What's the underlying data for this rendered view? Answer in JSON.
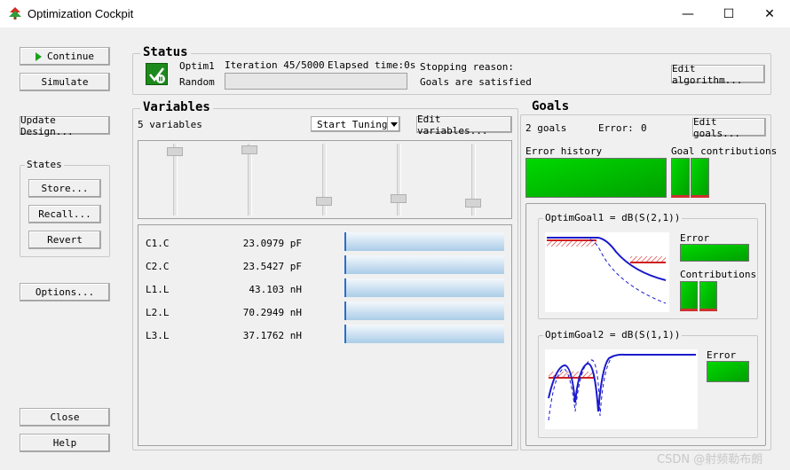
{
  "window": {
    "title": "Optimization Cockpit",
    "minimize": "—",
    "maximize": "☐",
    "close": "✕"
  },
  "left": {
    "continue": "Continue",
    "simulate": "Simulate",
    "update_design": "Update Design...",
    "states_title": "States",
    "store": "Store...",
    "recall": "Recall...",
    "revert": "Revert",
    "options": "Options...",
    "close_btn": "Close",
    "help": "Help"
  },
  "status": {
    "title": "Status",
    "optimizer": "Optim1",
    "method": "Random",
    "iteration": "Iteration 45/5000",
    "elapsed": "Elapsed time:0s",
    "progress": 0.0,
    "stopping_label": "Stopping reason:",
    "stopping_value": "Goals are satisfied",
    "edit_algorithm": "Edit algorithm..."
  },
  "variables": {
    "title": "Variables",
    "count": "5 variables",
    "start_tuning": "Start Tuning",
    "edit_variables": "Edit variables...",
    "sliders": [
      0.05,
      0.03,
      0.85,
      0.8,
      0.88
    ],
    "items": [
      {
        "name": "C1.C",
        "value": "23.0979 pF",
        "fill": 1.0
      },
      {
        "name": "C2.C",
        "value": "23.5427 pF",
        "fill": 1.0
      },
      {
        "name": "L1.L",
        "value": "43.103 nH",
        "fill": 1.0
      },
      {
        "name": "L2.L",
        "value": "70.2949 nH",
        "fill": 1.0
      },
      {
        "name": "L3.L",
        "value": "37.1762 nH",
        "fill": 1.0
      }
    ]
  },
  "goals": {
    "title": "Goals",
    "count": "2 goals",
    "error_label": "Error:",
    "error_value": "0",
    "edit_goals": "Edit goals...",
    "error_history": "Error history",
    "goal_contributions": "Goal contributions",
    "goal1": {
      "name": "OptimGoal1 = dB(S(2,1))",
      "error": "Error",
      "contributions": "Contributions"
    },
    "goal2": {
      "name": "OptimGoal2 = dB(S(1,1))",
      "error": "Error"
    }
  },
  "watermark": "CSDN @射频勒布朗"
}
